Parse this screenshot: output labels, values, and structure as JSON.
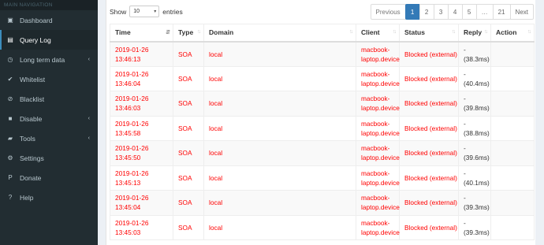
{
  "sidebar": {
    "header": "MAIN NAVIGATION",
    "items": [
      {
        "label": "Dashboard",
        "icon": "dashboard-icon",
        "glyph": "▣",
        "has_children": false,
        "active": false
      },
      {
        "label": "Query Log",
        "icon": "file-icon",
        "glyph": "▤",
        "has_children": false,
        "active": true
      },
      {
        "label": "Long term data",
        "icon": "history-icon",
        "glyph": "◷",
        "has_children": true,
        "active": false
      },
      {
        "label": "Whitelist",
        "icon": "check-circle-icon",
        "glyph": "✔",
        "has_children": false,
        "active": false
      },
      {
        "label": "Blacklist",
        "icon": "ban-icon",
        "glyph": "⊘",
        "has_children": false,
        "active": false
      },
      {
        "label": "Disable",
        "icon": "stop-icon",
        "glyph": "■",
        "has_children": true,
        "active": false
      },
      {
        "label": "Tools",
        "icon": "folder-icon",
        "glyph": "▰",
        "has_children": true,
        "active": false
      },
      {
        "label": "Settings",
        "icon": "gears-icon",
        "glyph": "⚙",
        "has_children": false,
        "active": false
      },
      {
        "label": "Donate",
        "icon": "paypal-icon",
        "glyph": "P",
        "has_children": false,
        "active": false
      },
      {
        "label": "Help",
        "icon": "question-circle-icon",
        "glyph": "?",
        "has_children": false,
        "active": false
      }
    ]
  },
  "table_controls": {
    "show_label": "Show",
    "entries_value": "10",
    "entries_label": "entries"
  },
  "pagination": {
    "previous": "Previous",
    "pages": [
      "1",
      "2",
      "3",
      "4",
      "5",
      "…",
      "21"
    ],
    "active_page": "1",
    "next": "Next"
  },
  "table": {
    "columns": [
      "Time",
      "Type",
      "Domain",
      "Client",
      "Status",
      "Reply",
      "Action"
    ],
    "rows": [
      {
        "time": "2019-01-26 13:46:13",
        "type": "SOA",
        "domain": "local",
        "client": "macbook-laptop.device",
        "status": "Blocked (external)",
        "reply": "- (38.3ms)",
        "action": ""
      },
      {
        "time": "2019-01-26 13:46:04",
        "type": "SOA",
        "domain": "local",
        "client": "macbook-laptop.device",
        "status": "Blocked (external)",
        "reply": "- (40.4ms)",
        "action": ""
      },
      {
        "time": "2019-01-26 13:46:03",
        "type": "SOA",
        "domain": "local",
        "client": "macbook-laptop.device",
        "status": "Blocked (external)",
        "reply": "- (39.8ms)",
        "action": ""
      },
      {
        "time": "2019-01-26 13:45:58",
        "type": "SOA",
        "domain": "local",
        "client": "macbook-laptop.device",
        "status": "Blocked (external)",
        "reply": "- (38.8ms)",
        "action": ""
      },
      {
        "time": "2019-01-26 13:45:50",
        "type": "SOA",
        "domain": "local",
        "client": "macbook-laptop.device",
        "status": "Blocked (external)",
        "reply": "- (39.6ms)",
        "action": ""
      },
      {
        "time": "2019-01-26 13:45:13",
        "type": "SOA",
        "domain": "local",
        "client": "macbook-laptop.device",
        "status": "Blocked (external)",
        "reply": "- (40.1ms)",
        "action": ""
      },
      {
        "time": "2019-01-26 13:45:04",
        "type": "SOA",
        "domain": "local",
        "client": "macbook-laptop.device",
        "status": "Blocked (external)",
        "reply": "- (39.3ms)",
        "action": ""
      },
      {
        "time": "2019-01-26 13:45:03",
        "type": "SOA",
        "domain": "local",
        "client": "macbook-laptop.device",
        "status": "Blocked (external)",
        "reply": "- (39.3ms)",
        "action": ""
      }
    ]
  },
  "colors": {
    "sidebar_bg": "#222d32",
    "active_accent": "#3c8dbc",
    "blocked_text": "#ff0000",
    "page_active": "#337ab7"
  }
}
